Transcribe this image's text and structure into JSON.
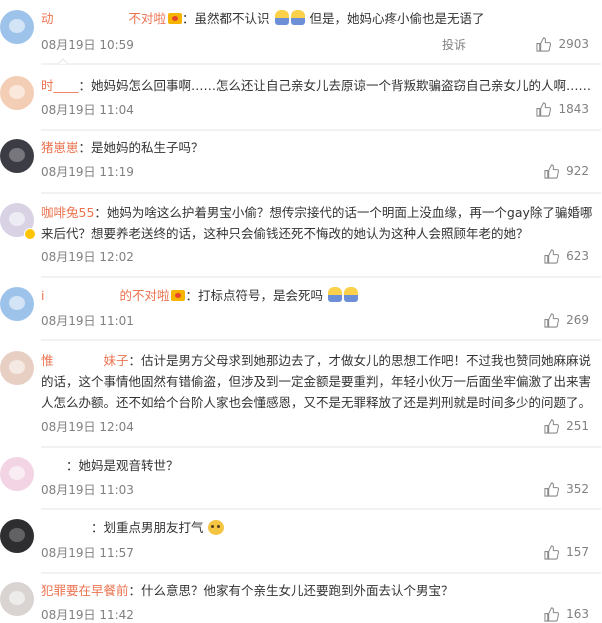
{
  "comments": [
    {
      "username": "动　　　　　　不对啦",
      "text": "：虽然都不认识",
      "text2": " 但是，她妈心疼小偷也是无语了",
      "time": "08月19日 10:59",
      "likes": "2903",
      "report": "投诉",
      "avatar_color": "#9ec3ea"
    },
    {
      "username": "时____",
      "text": "：她妈妈怎么回事啊……怎么还让自己亲女儿去原谅一个背叛欺骗盗窃自己亲女儿的人啊……",
      "time": "08月19日 11:04",
      "likes": "1843",
      "avatar_color": "#f3cdb4"
    },
    {
      "username": "猪崽崽",
      "text": "：是她妈的私生子吗？",
      "time": "08月19日 11:19",
      "likes": "922",
      "avatar_color": "#3c3c44"
    },
    {
      "username": "咖啡兔55",
      "text": "：她妈为啥这么护着男宝小偷？想传宗接代的话一个明面上没血缘，再一个gay除了骗婚哪来后代？想要养老送终的话，这种只会偷钱还死不悔改的她认为这种人会照顾年老的她？",
      "time": "08月19日 12:02",
      "likes": "623",
      "avatar_color": "#d8d2e4"
    },
    {
      "username": "i　　　　　　的不对啦",
      "text": "：打标点符号，是会死吗",
      "time": "08月19日 11:01",
      "likes": "269",
      "avatar_color": "#9ec3ea"
    },
    {
      "username": "惟　　　　妹子",
      "text": "：估计是男方父母求到她那边去了，才做女儿的思想工作吧！不过我也赞同她麻麻说的话，这个事情他固然有错偷盗，但涉及到一定金额是要重判，年轻小伙万一后面坐牢偏激了出来害人怎么办额。还不如给个台阶人家也会懂感恩，又不是无罪释放了还是判刑就是时间多少的问题了。",
      "time": "08月19日 12:04",
      "likes": "251",
      "avatar_color": "#e8cfc4"
    },
    {
      "username": "　　",
      "text": "：她妈是观音转世？",
      "time": "08月19日 11:03",
      "likes": "352",
      "avatar_color": "#f2d4e4"
    },
    {
      "username": "　　　　",
      "text": "：划重点男朋友打气",
      "time": "08月19日 11:57",
      "likes": "157",
      "avatar_color": "#2e2e30"
    },
    {
      "username": "犯罪要在早餐前",
      "text": "：什么意思？他家有个亲生女儿还要跑到外面去认个男宝？",
      "time": "08月19日 11:42",
      "likes": "163",
      "avatar_color": "#d9d4d2"
    }
  ],
  "colors": {
    "username": "#eb7350",
    "text": "#333333",
    "meta": "#808080",
    "divider": "#e6e6e6"
  },
  "icons": [
    "thumb-up-icon",
    "emoji-icon",
    "crown-badge-icon",
    "verified-badge-icon",
    "cat-emoji-icon"
  ]
}
